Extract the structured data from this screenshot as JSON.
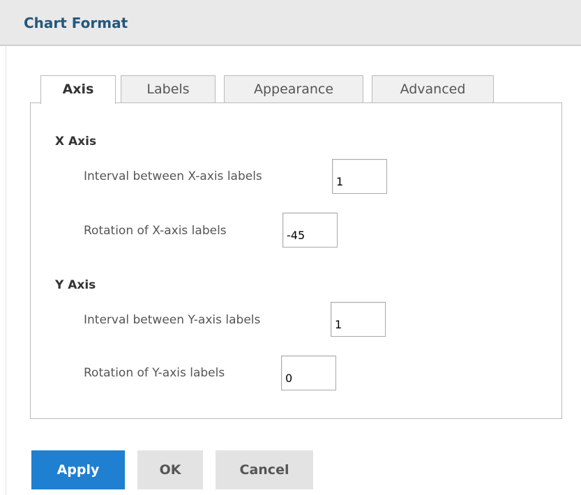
{
  "dialog": {
    "title": "Chart Format"
  },
  "tabs": [
    {
      "label": "Axis",
      "active": true
    },
    {
      "label": "Labels",
      "active": false
    },
    {
      "label": "Appearance",
      "active": false
    },
    {
      "label": "Advanced",
      "active": false
    }
  ],
  "x_axis": {
    "title": "X Axis",
    "interval_label": "Interval between X-axis labels",
    "interval_value": "1",
    "rotation_label": "Rotation of X-axis labels",
    "rotation_value": "-45"
  },
  "y_axis": {
    "title": "Y Axis",
    "interval_label": "Interval between Y-axis labels",
    "interval_value": "1",
    "rotation_label": "Rotation of Y-axis labels",
    "rotation_value": "0"
  },
  "buttons": {
    "apply": "Apply",
    "ok": "OK",
    "cancel": "Cancel"
  },
  "colors": {
    "title": "#25577d",
    "primary_button": "#1f7fd0",
    "secondary_button": "#e3e3e3",
    "header_bg": "#e9e9e9"
  }
}
